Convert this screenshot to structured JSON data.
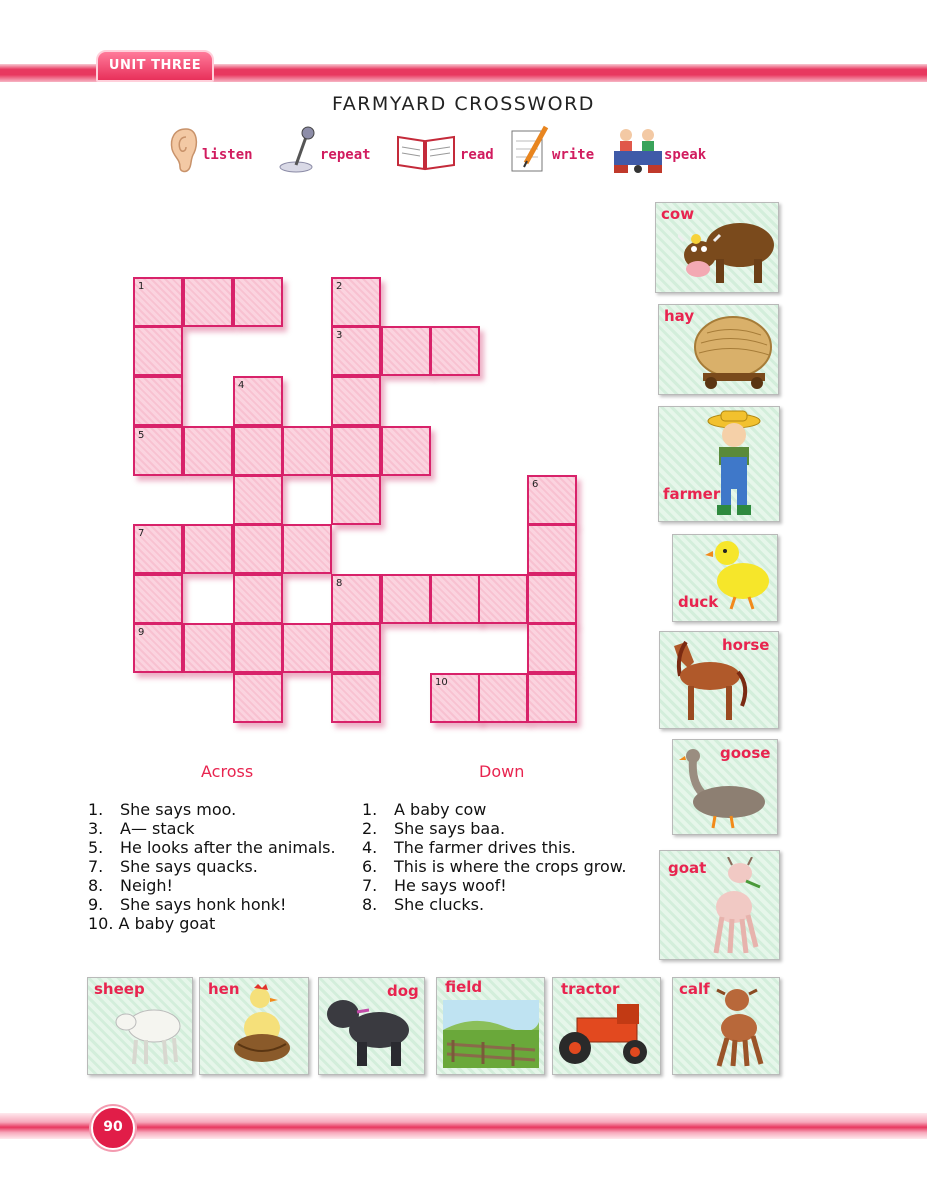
{
  "header": {
    "unit_label": "UNIT THREE",
    "title": "FARMYARD CROSSWORD"
  },
  "skills": [
    {
      "icon": "ear-icon",
      "label": "listen"
    },
    {
      "icon": "microphone-icon",
      "label": "repeat"
    },
    {
      "icon": "book-icon",
      "label": "read"
    },
    {
      "icon": "pencil-paper-icon",
      "label": "write"
    },
    {
      "icon": "children-talking-icon",
      "label": "speak"
    }
  ],
  "crossword": {
    "numbers": [
      "1",
      "2",
      "3",
      "4",
      "5",
      "6",
      "7",
      "8",
      "9",
      "10"
    ]
  },
  "clues": {
    "across_title": "Across",
    "down_title": "Down",
    "across": [
      {
        "num": "1.",
        "text": "She says moo."
      },
      {
        "num": "3.",
        "text": "A— stack"
      },
      {
        "num": "5.",
        "text": "He looks after the animals."
      },
      {
        "num": "7.",
        "text": "She says quacks."
      },
      {
        "num": "8.",
        "text": "Neigh!"
      },
      {
        "num": "9.",
        "text": "She says honk honk!"
      },
      {
        "num": "10.",
        "text": "A baby goat"
      }
    ],
    "down": [
      {
        "num": "1.",
        "text": "A baby cow"
      },
      {
        "num": "2.",
        "text": "She says baa."
      },
      {
        "num": "4.",
        "text": "The farmer drives this."
      },
      {
        "num": "6.",
        "text": "This is where the crops grow."
      },
      {
        "num": "7.",
        "text": "He says woof!"
      },
      {
        "num": "8.",
        "text": "She clucks."
      }
    ]
  },
  "picture_cards": {
    "right": [
      "cow",
      "hay",
      "farmer",
      "duck",
      "horse",
      "goose",
      "goat"
    ],
    "bottom": [
      "sheep",
      "hen",
      "dog",
      "field",
      "tractor",
      "calf"
    ]
  },
  "footer": {
    "page_number": "90"
  },
  "colors": {
    "accent": "#e8244f",
    "grid_border": "#d8226a",
    "grid_fill": "#fbd3df",
    "card_bg": "#e6f6ea"
  }
}
